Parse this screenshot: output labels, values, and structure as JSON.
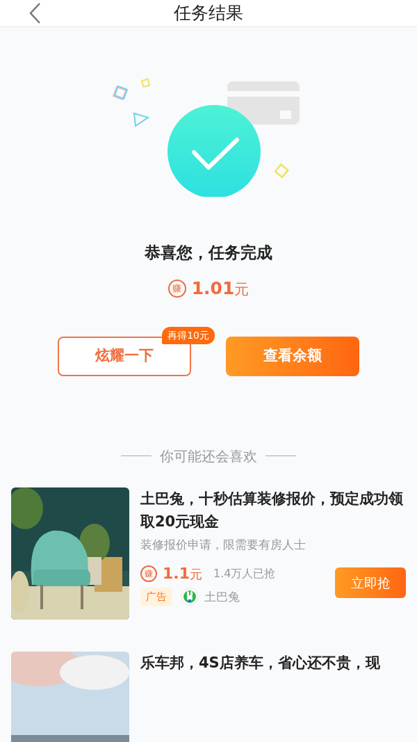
{
  "header": {
    "title": "任务结果"
  },
  "result": {
    "message": "恭喜您，任务完成",
    "earn_badge": "赚",
    "amount": "1.01",
    "unit": "元"
  },
  "actions": [
    {
      "kind": "outline",
      "label": "炫耀一下",
      "tag": "再得10元"
    },
    {
      "kind": "filled",
      "label": "查看余额"
    }
  ],
  "recommend": {
    "heading": "你可能还会喜欢",
    "items": [
      {
        "kind": "picture",
        "title": "土巴兔，十秒估算装修报价，预定成功领取20元现金",
        "subtitle": "装修报价申请，限需要有房人士",
        "earn_badge": "赚",
        "amount": "1.1",
        "unit": "元",
        "grabbed": "1.4万人已抢",
        "ad_tag": "广告",
        "advertiser": "土巴兔",
        "button": "立即抢"
      },
      {
        "kind": "picture",
        "title": "乐车邦，4S店养车，省心还不贵，现"
      }
    ]
  }
}
